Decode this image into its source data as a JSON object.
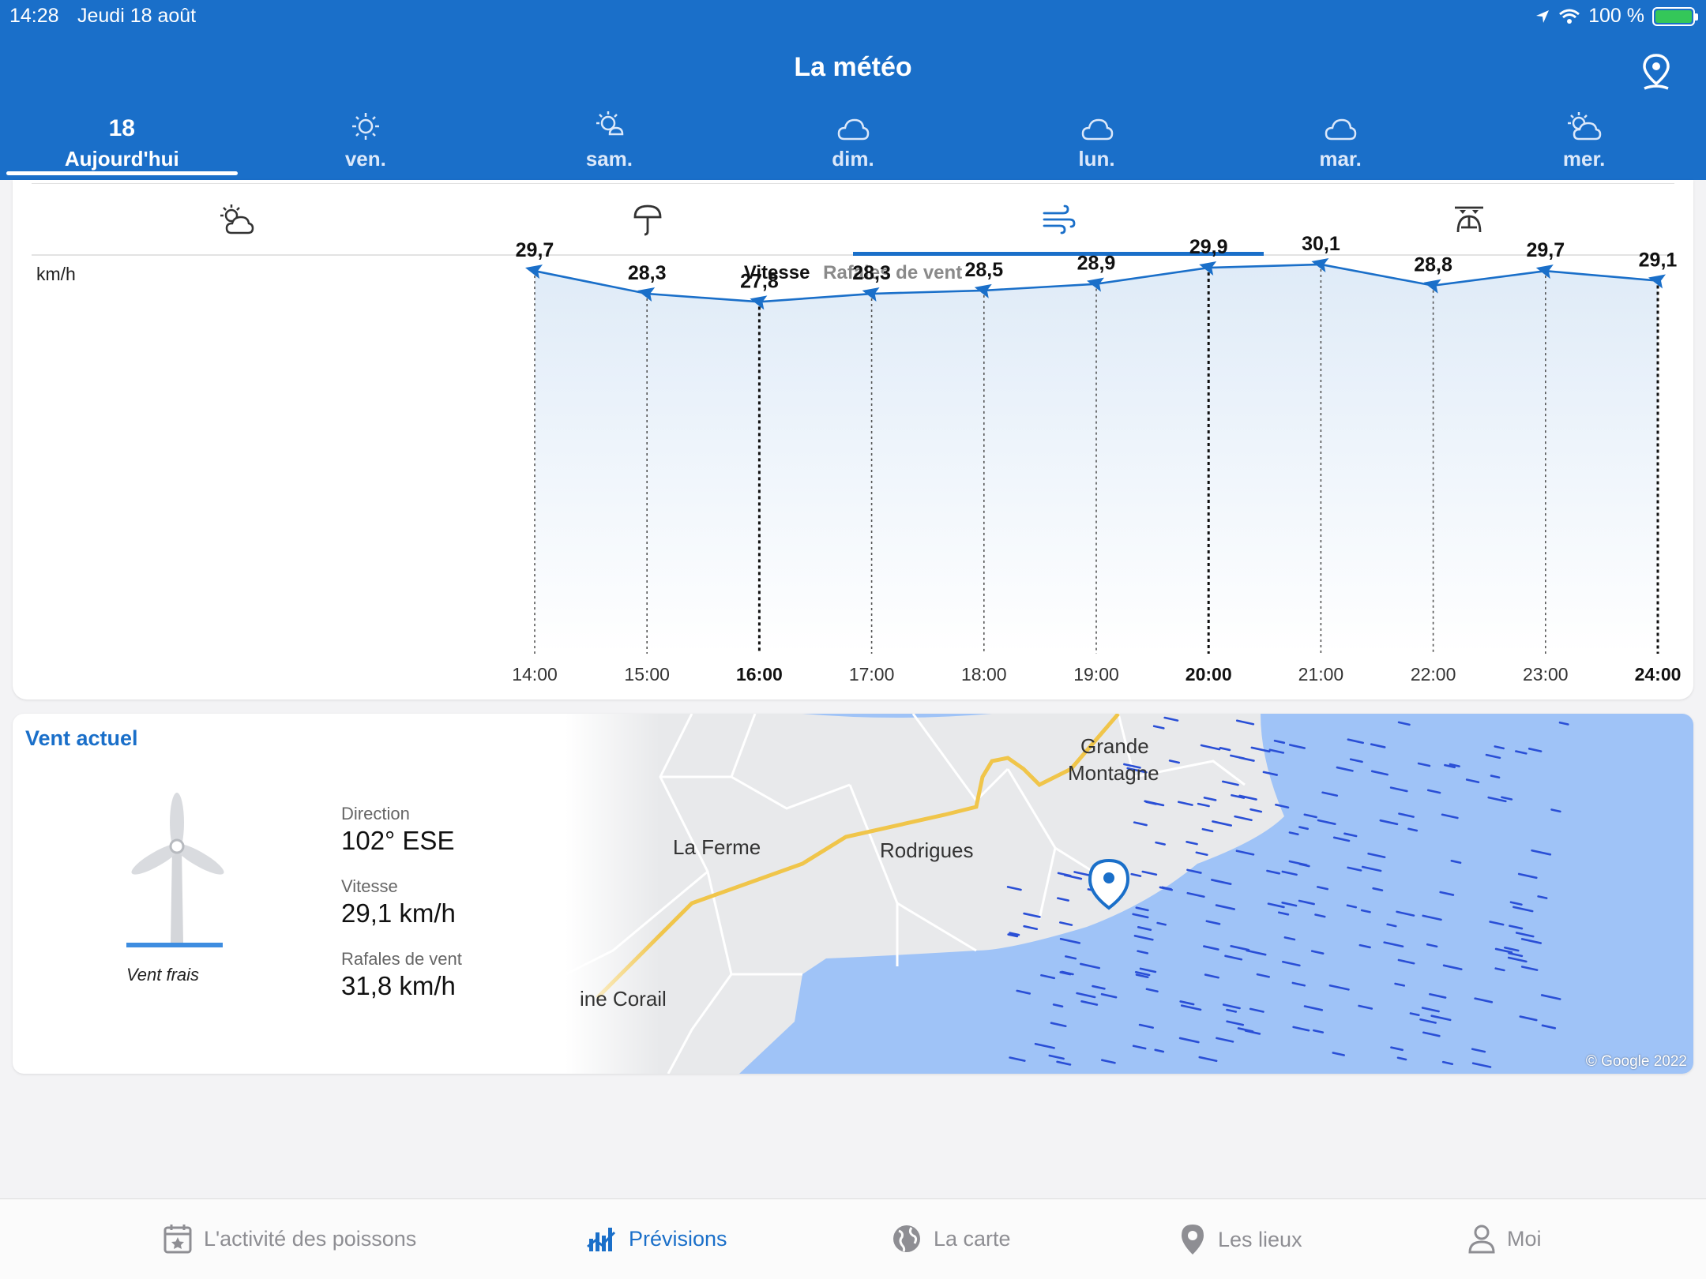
{
  "status": {
    "time": "14:28",
    "date": "Jeudi 18 août",
    "battery": "100 %"
  },
  "header": {
    "title": "La météo"
  },
  "day_tabs": [
    {
      "top": "18",
      "label": "Aujourd'hui",
      "icon": "date"
    },
    {
      "label": "ven.",
      "icon": "sun-icon"
    },
    {
      "label": "sam.",
      "icon": "sun-cloud-icon"
    },
    {
      "label": "dim.",
      "icon": "cloud-icon"
    },
    {
      "label": "lun.",
      "icon": "cloud-icon"
    },
    {
      "label": "mar.",
      "icon": "cloud-icon"
    },
    {
      "label": "mer.",
      "icon": "sun-behind-cloud-icon"
    }
  ],
  "sub_tabs": [
    "weather-icon",
    "umbrella-icon",
    "wind-icon",
    "pressure-icon"
  ],
  "chart": {
    "unit": "km/h",
    "legend_active": "Vitesse",
    "legend_inactive": "Rafales de vent"
  },
  "chart_data": {
    "type": "line",
    "x": [
      "14:00",
      "15:00",
      "16:00",
      "17:00",
      "18:00",
      "19:00",
      "20:00",
      "21:00",
      "22:00",
      "23:00",
      "24:00"
    ],
    "bold_ticks": [
      "16:00",
      "20:00",
      "24:00"
    ],
    "series": [
      {
        "name": "Vitesse",
        "values": [
          29.7,
          28.3,
          27.8,
          28.3,
          28.5,
          28.9,
          29.9,
          30.1,
          28.8,
          29.7,
          29.1
        ]
      }
    ],
    "value_labels": [
      "29,7",
      "28,3",
      "27,8",
      "28,3",
      "28,5",
      "28,9",
      "29,9",
      "30,1",
      "28,8",
      "29,7",
      "29,1"
    ],
    "ylabel": "km/h",
    "color": "#1a6fc9"
  },
  "current_wind": {
    "title": "Vent actuel",
    "classification": "Vent frais",
    "direction_label": "Direction",
    "direction_value": "102° ESE",
    "speed_label": "Vitesse",
    "speed_value": "29,1 km/h",
    "gust_label": "Rafales de vent",
    "gust_value": "31,8 km/h"
  },
  "map": {
    "labels": [
      "Grande",
      "Montagne",
      "La Ferme",
      "Rodrigues",
      "ine Corail"
    ],
    "copyright": "© Google 2022"
  },
  "nav": [
    {
      "label": "L'activité des poissons",
      "icon": "calendar-star-icon",
      "active": false
    },
    {
      "label": "Prévisions",
      "icon": "forecast-chart-icon",
      "active": true
    },
    {
      "label": "La carte",
      "icon": "globe-icon",
      "active": false
    },
    {
      "label": "Les lieux",
      "icon": "location-pin-icon",
      "active": false
    },
    {
      "label": "Moi",
      "icon": "person-icon",
      "active": false
    }
  ]
}
